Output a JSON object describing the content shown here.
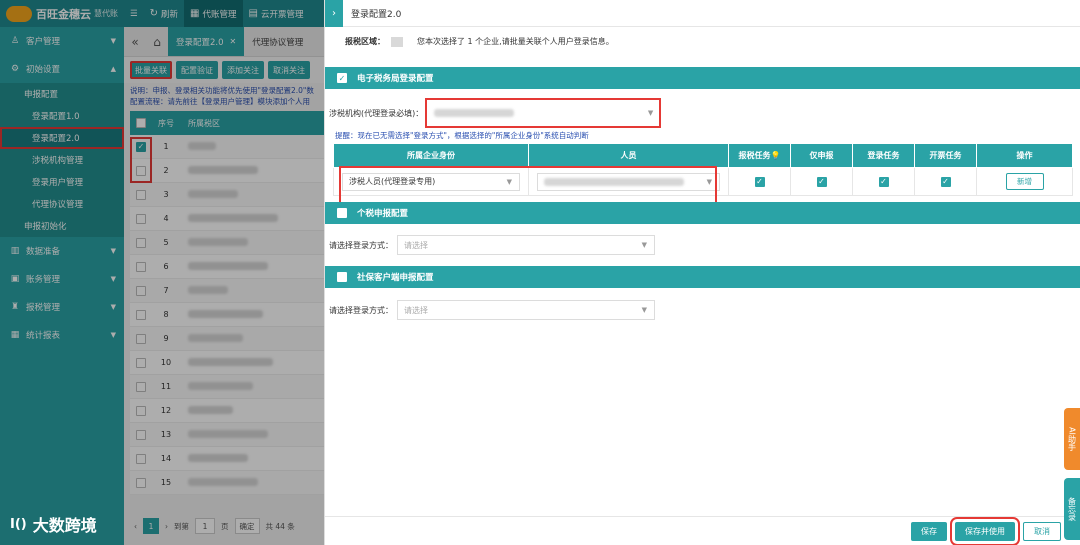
{
  "topbar": {
    "brand": "百旺金穗云",
    "brand_sub": "慧代账",
    "logo_text": "Baiwang",
    "menu": [
      {
        "label": "刷新",
        "icon": "refresh-icon",
        "glyph": "↻"
      },
      {
        "label": "代账管理",
        "icon": "grid-icon",
        "glyph": "▦"
      },
      {
        "label": "云开票管理",
        "icon": "invoice-icon",
        "glyph": "▤"
      }
    ]
  },
  "sidebar": {
    "groups": [
      {
        "label": "客户管理",
        "icon": "user-icon",
        "glyph": "👤"
      },
      {
        "label": "初始设置",
        "icon": "settings-icon",
        "glyph": "⚙"
      }
    ],
    "sub_title": "申报配置",
    "leaves": [
      "登录配置1.0",
      "登录配置2.0",
      "涉税机构管理",
      "登录用户管理",
      "代理协议管理"
    ],
    "sub_bottom": "申报初始化",
    "groups_bottom": [
      {
        "label": "数据准备",
        "icon": "database-icon",
        "glyph": "▥"
      },
      {
        "label": "账务管理",
        "icon": "ledger-icon",
        "glyph": "▣"
      },
      {
        "label": "报税管理",
        "icon": "tax-icon",
        "glyph": "♜"
      },
      {
        "label": "统计报表",
        "icon": "report-icon",
        "glyph": "▦"
      }
    ]
  },
  "main": {
    "tabs": [
      {
        "label": "登录配置2.0"
      },
      {
        "label": "代理协议管理"
      }
    ],
    "actions": [
      "批量关联",
      "配置验证",
      "添加关注",
      "取消关注"
    ],
    "notes_line1": "说明：申报、登录相关功能将优先使用\"登录配置2.0\"数",
    "notes_line2": "配置流程：请先前往【登录用户管理】模块添加个人用",
    "table_headers": {
      "no": "序号",
      "area": "所属税区"
    },
    "row_numbers": [
      "1",
      "2",
      "3",
      "4",
      "5",
      "6",
      "7",
      "8",
      "9",
      "10",
      "11",
      "12",
      "13",
      "14",
      "15"
    ],
    "pager": {
      "page": "1",
      "goto": "到第",
      "page_input": "1",
      "page_unit": "页",
      "confirm": "确定",
      "total": "共 44 条"
    }
  },
  "watermark": {
    "logo": "Ⅰ()",
    "text": "大数跨境"
  },
  "drawer": {
    "title": "登录配置2.0",
    "area_label": "报税区域：",
    "area_message": "您本次选择了 1 个企业,请批量关联个人用户登录信息。",
    "section_etax": "电子税务局登录配置",
    "agency_label": "涉税机构(代理登录必填)：",
    "hint": "提醒：现在已无需选择\"登录方式\"，根据选择的\"所属企业身份\"系统自动判断",
    "table_headers": [
      "所属企业身份",
      "人员",
      "报税任务",
      "仅申报",
      "登录任务",
      "开票任务",
      "操作"
    ],
    "row": {
      "identity": "涉税人员(代理登录专用)",
      "add_button": "新增"
    },
    "section_personal": "个税申报配置",
    "section_social": "社保客户端申报配置",
    "login_method_label": "请选择登录方式：",
    "select_placeholder": "请选择",
    "footer": {
      "save": "保存",
      "save_use": "保存并使用",
      "cancel": "取消"
    }
  },
  "float_tabs": {
    "ai": "AI助手",
    "memo": "备忘录"
  },
  "colors": {
    "brand": "#2aa3a6",
    "topbar": "#1f8a8f",
    "highlight": "#e53935",
    "ai_tab": "#f08a2c"
  }
}
